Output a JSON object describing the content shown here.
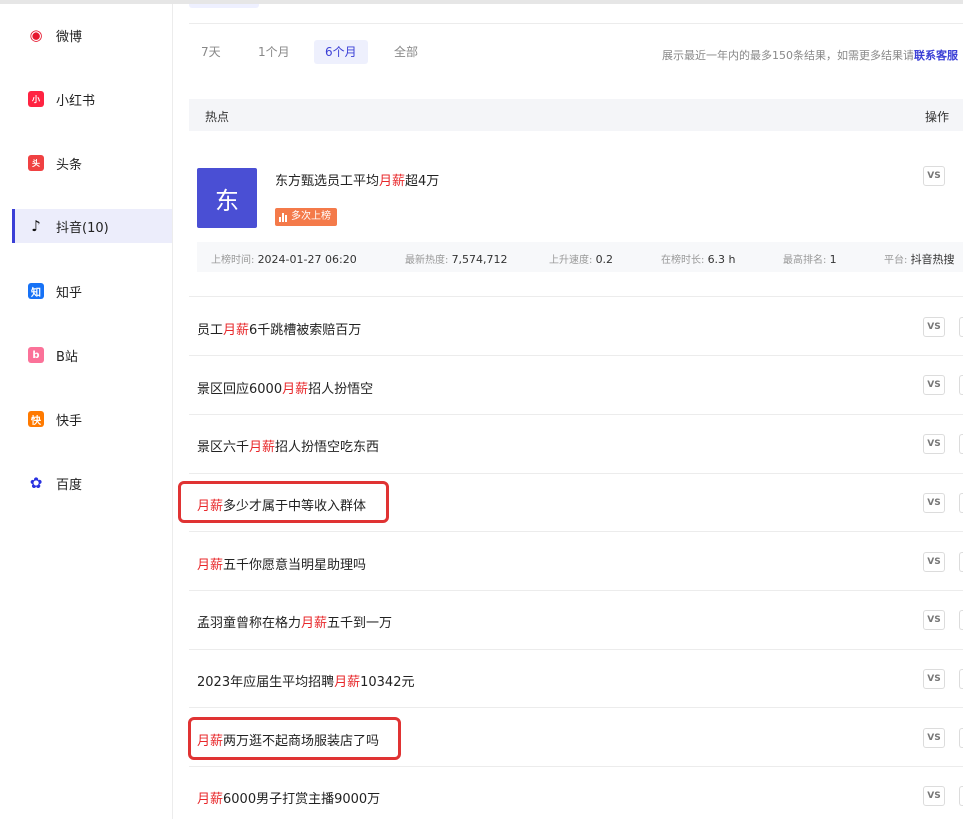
{
  "sidebar": {
    "items": [
      {
        "label": "微博",
        "icon": "weibo-icon",
        "color": "#e6162d",
        "glyph": "●"
      },
      {
        "label": "小红书",
        "icon": "xiaohongshu-icon",
        "color": "#ff2442",
        "glyph": "小"
      },
      {
        "label": "头条",
        "icon": "toutiao-icon",
        "color": "#f04142",
        "glyph": "头"
      },
      {
        "label": "抖音(10)",
        "icon": "douyin-icon",
        "color": "#111111",
        "glyph": "♪"
      },
      {
        "label": "知乎",
        "icon": "zhihu-icon",
        "color": "#1772f6",
        "glyph": "知"
      },
      {
        "label": "B站",
        "icon": "bilibili-icon",
        "color": "#fb7299",
        "glyph": "b"
      },
      {
        "label": "快手",
        "icon": "kuaishou-icon",
        "color": "#ff7a00",
        "glyph": "快"
      },
      {
        "label": "百度",
        "icon": "baidu-icon",
        "color": "#2932e1",
        "glyph": "✿"
      }
    ]
  },
  "tabs": [
    {
      "label": "7天"
    },
    {
      "label": "1个月"
    },
    {
      "label": "6个月"
    },
    {
      "label": "全部"
    }
  ],
  "notice": {
    "text": "展示最近一年内的最多150条结果，如需更多结果请",
    "link": "联系客服"
  },
  "table": {
    "col_hotspot": "热点",
    "col_action": "操作",
    "vs_label": "VS"
  },
  "featured": {
    "avatar": "东",
    "title_pre": "东方甄选员工平均",
    "keyword": "月薪",
    "title_post": "超4万",
    "badge": "多次上榜",
    "meta": [
      {
        "label": "上榜时间:",
        "value": "2024-01-27 06:20"
      },
      {
        "label": "最新热度:",
        "value": "7,574,712"
      },
      {
        "label": "上升速度:",
        "value": "0.2"
      },
      {
        "label": "在榜时长:",
        "value": "6.3 h"
      },
      {
        "label": "最高排名:",
        "value": "1"
      },
      {
        "label": "平台:",
        "value": "抖音热搜"
      }
    ]
  },
  "rows": [
    {
      "pre": "员工",
      "kw": "月薪",
      "post": "6千跳槽被索赔百万"
    },
    {
      "pre": "景区回应6000",
      "kw": "月薪",
      "post": "招人扮悟空"
    },
    {
      "pre": "景区六千",
      "kw": "月薪",
      "post": "招人扮悟空吃东西"
    },
    {
      "pre": "",
      "kw": "月薪",
      "post": "多少才属于中等收入群体"
    },
    {
      "pre": "",
      "kw": "月薪",
      "post": "五千你愿意当明星助理吗"
    },
    {
      "pre": "孟羽童曾称在格力",
      "kw": "月薪",
      "post": "五千到一万"
    },
    {
      "pre": "2023年应届生平均招聘",
      "kw": "月薪",
      "post": "10342元"
    },
    {
      "pre": "",
      "kw": "月薪",
      "post": "两万逛不起商场服装店了吗"
    },
    {
      "pre": "",
      "kw": "月薪",
      "post": "6000男子打赏主播9000万"
    }
  ],
  "colors": {
    "accent": "#3b3fd6",
    "keyword": "#e8282b",
    "highlight_box": "#e03333"
  }
}
